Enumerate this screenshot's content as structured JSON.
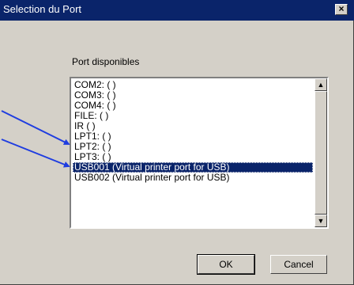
{
  "window": {
    "title": "Selection du Port",
    "close_glyph": "×"
  },
  "port_list": {
    "label": "Port disponibles",
    "items": [
      "COM2: (       )",
      "COM3: (       )",
      "COM4: (       )",
      "FILE: (       )",
      "IR (       )",
      "LPT1: (       )",
      "LPT2: (       )",
      "LPT3: (       )",
      "USB001 (Virtual printer port for USB)",
      "USB002 (Virtual printer port for USB)"
    ],
    "selected_index": 8
  },
  "scrollbar": {
    "up_icon": "▲",
    "down_icon": "▼"
  },
  "buttons": {
    "ok": "OK",
    "cancel": "Cancel"
  },
  "annotations": {
    "arrow_color": "#1f3de0"
  },
  "colors": {
    "title_bar": "#0a246a",
    "dialog_face": "#d4d0c8",
    "selection": "#0a246a"
  }
}
